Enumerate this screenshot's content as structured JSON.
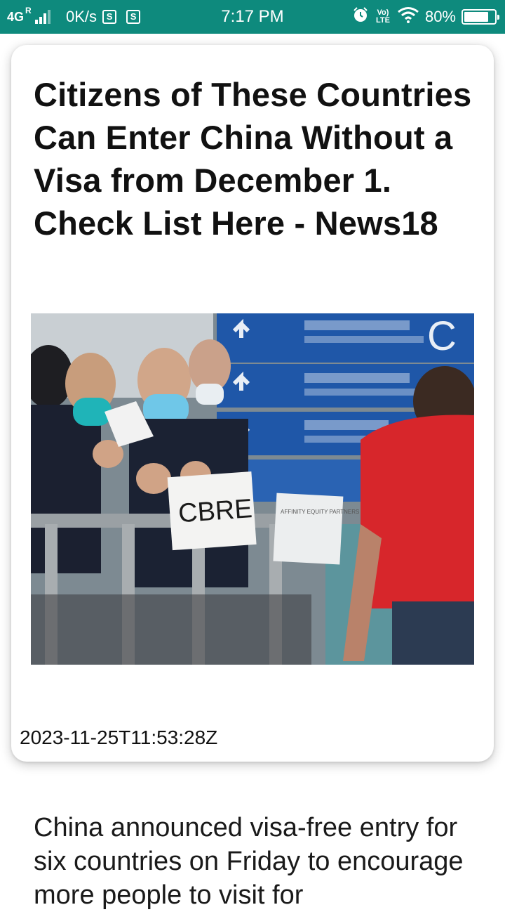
{
  "status_bar": {
    "network": "4G",
    "network_sup": "R",
    "speed": "0K/s",
    "time": "7:17 PM",
    "volte": "Vo) LTE",
    "battery": "80%",
    "battery_level": 0.8,
    "notif_icon_label": "S"
  },
  "article": {
    "headline": "Citizens of These Countries Can Enter China Without a Visa from December 1. Check List Here - News18",
    "timestamp": "2023-11-25T11:53:28Z",
    "summary": "China announced visa-free entry for six countries on Friday to encourage more people to visit for",
    "photo": {
      "sign_main": "CBRE",
      "sign_small": "AFFINITY EQUITY PARTNERS",
      "overhead_letter": "C"
    }
  },
  "colors": {
    "status_bar": "#0e8a7d",
    "card_bg": "#ffffff",
    "text": "#111111"
  }
}
